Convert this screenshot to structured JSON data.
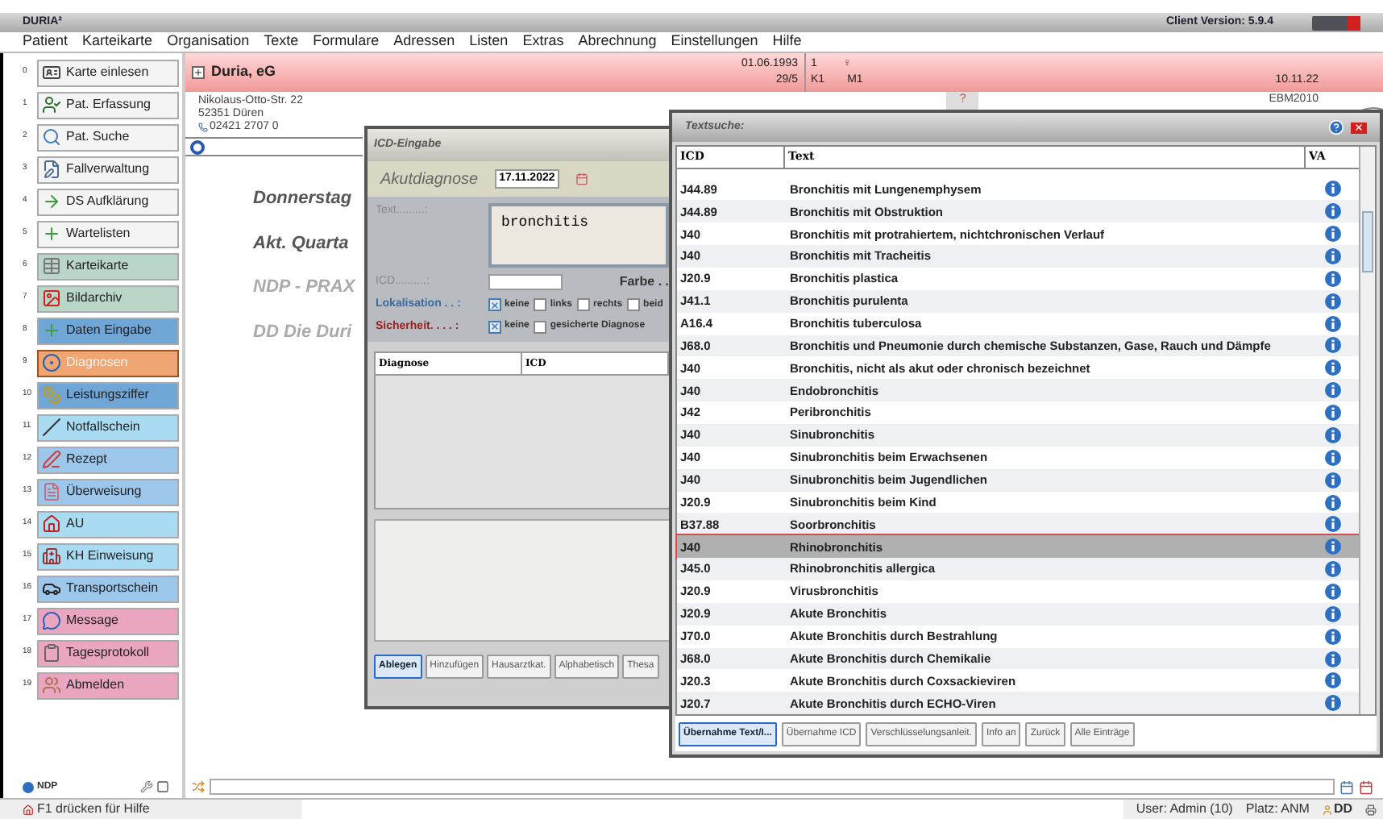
{
  "window": {
    "title": "DURIA²",
    "version": "Client Version: 5.9.4"
  },
  "menu": [
    "Patient",
    "Karteikarte",
    "Organisation",
    "Texte",
    "Formulare",
    "Adressen",
    "Listen",
    "Extras",
    "Abrechnung",
    "Einstellungen",
    "Hilfe"
  ],
  "sidebar": {
    "items": [
      {
        "number": "0",
        "label": "Karte einlesen",
        "color": "#f4f4f4",
        "selected": false
      },
      {
        "number": "1",
        "label": "Pat. Erfassung",
        "color": "#f4f4f4",
        "selected": false
      },
      {
        "number": "2",
        "label": "Pat. Suche",
        "color": "#f4f4f4",
        "selected": false
      },
      {
        "number": "3",
        "label": "Fallverwaltung",
        "color": "#f4f4f4",
        "selected": false
      },
      {
        "number": "4",
        "label": "DS Aufklärung",
        "color": "#f4f4f4",
        "selected": false
      },
      {
        "number": "5",
        "label": "Wartelisten",
        "color": "#f4f4f4",
        "selected": false
      },
      {
        "number": "6",
        "label": "Karteikarte",
        "color": "#b9d6c9",
        "selected": false
      },
      {
        "number": "7",
        "label": "Bildarchiv",
        "color": "#b9d6c9",
        "selected": false
      },
      {
        "number": "8",
        "label": "Daten Eingabe",
        "color": "#6fa6d6",
        "selected": false
      },
      {
        "number": "9",
        "label": "Diagnosen",
        "color": "#f0a672",
        "selected": true
      },
      {
        "number": "10",
        "label": "Leistungsziffer",
        "color": "#6fa6d6",
        "selected": false
      },
      {
        "number": "11",
        "label": "Notfallschein",
        "color": "#a9dcf2",
        "selected": false
      },
      {
        "number": "12",
        "label": "Rezept",
        "color": "#9cc6ea",
        "selected": false
      },
      {
        "number": "13",
        "label": "Überweisung",
        "color": "#9cc6ea",
        "selected": false
      },
      {
        "number": "14",
        "label": "AU",
        "color": "#a9dcf2",
        "selected": false
      },
      {
        "number": "15",
        "label": "KH Einweisung",
        "color": "#a9dcf2",
        "selected": false
      },
      {
        "number": "16",
        "label": "Transportschein",
        "color": "#9cc6ea",
        "selected": false
      },
      {
        "number": "17",
        "label": "Message",
        "color": "#eaa6c0",
        "selected": false
      },
      {
        "number": "18",
        "label": "Tagesprotokoll",
        "color": "#eaa6c0",
        "selected": false
      },
      {
        "number": "19",
        "label": "Abmelden",
        "color": "#eaa6c0",
        "selected": false
      }
    ],
    "footer": "NDP"
  },
  "patient": {
    "name": "Duria, eG",
    "birthdate": "01.06.1993",
    "code": "29/5",
    "count": "1",
    "gender": "♀",
    "k": "K1",
    "m": "M1",
    "date": "10.11.22",
    "question": "?",
    "ebm": "EBM2010",
    "street": "Nikolaus-Otto-Str. 22",
    "city": "52351 Düren",
    "phone": "02421 2707 0"
  },
  "main_lines": [
    "Donnerstag",
    "Akt. Quarta",
    "NDP - PRAX",
    "DD Die Duri"
  ],
  "icd_dialog": {
    "title": "ICD-Eingabe",
    "heading": "Akutdiagnose",
    "date": "17.11.2022",
    "text_label": "Text.........:",
    "text_value": "bronchitis",
    "icd_label": "ICD..........:",
    "farbe_label": "Farbe . .",
    "lokalisation_label": "Lokalisation . . :",
    "lokalisation": [
      {
        "label": "keine",
        "checked": true
      },
      {
        "label": "links",
        "checked": false
      },
      {
        "label": "rechts",
        "checked": false
      },
      {
        "label": "beid",
        "checked": false
      }
    ],
    "sicherheit_label": "Sicherheit. . . . :",
    "sicherheit": [
      {
        "label": "keine",
        "checked": true
      },
      {
        "label": "gesicherte Diagnose",
        "checked": false
      }
    ],
    "columns": [
      "Diagnose",
      "ICD"
    ],
    "buttons": [
      {
        "label": "Ablegen",
        "default": true
      },
      {
        "label": "Hinzufügen",
        "default": false
      },
      {
        "label": "Hausarztkat.",
        "default": false
      },
      {
        "label": "Alphabetisch",
        "default": false
      },
      {
        "label": "Thesa",
        "default": false
      }
    ]
  },
  "textsuche": {
    "title": "Textsuche:",
    "columns": [
      "ICD",
      "Text",
      "VA"
    ],
    "rows": [
      {
        "icd": "J44.89",
        "text": "Bronchitis mit Lungenemphysem",
        "selected": false
      },
      {
        "icd": "J44.89",
        "text": "Bronchitis mit Obstruktion",
        "selected": false
      },
      {
        "icd": "J40",
        "text": "Bronchitis mit protrahiertem, nichtchronischen Verlauf",
        "selected": false
      },
      {
        "icd": "J40",
        "text": "Bronchitis mit Tracheitis",
        "selected": false
      },
      {
        "icd": "J20.9",
        "text": "Bronchitis plastica",
        "selected": false
      },
      {
        "icd": "J41.1",
        "text": "Bronchitis purulenta",
        "selected": false
      },
      {
        "icd": "A16.4",
        "text": "Bronchitis tuberculosa",
        "selected": false
      },
      {
        "icd": "J68.0",
        "text": "Bronchitis und Pneumonie durch chemische Substanzen, Gase, Rauch und Dämpfe",
        "selected": false
      },
      {
        "icd": "J40",
        "text": "Bronchitis, nicht als akut oder chronisch bezeichnet",
        "selected": false
      },
      {
        "icd": "J40",
        "text": "Endobronchitis",
        "selected": false
      },
      {
        "icd": "J42",
        "text": "Peribronchitis",
        "selected": false
      },
      {
        "icd": "J40",
        "text": "Sinubronchitis",
        "selected": false
      },
      {
        "icd": "J40",
        "text": "Sinubronchitis beim Erwachsenen",
        "selected": false
      },
      {
        "icd": "J40",
        "text": "Sinubronchitis beim Jugendlichen",
        "selected": false
      },
      {
        "icd": "J20.9",
        "text": "Sinubronchitis beim Kind",
        "selected": false
      },
      {
        "icd": "B37.88",
        "text": "Soorbronchitis",
        "selected": false
      },
      {
        "icd": "J40",
        "text": "Rhinobronchitis",
        "selected": true
      },
      {
        "icd": "J45.0",
        "text": "Rhinobronchitis allergica",
        "selected": false
      },
      {
        "icd": "J20.9",
        "text": "Virusbronchitis",
        "selected": false
      },
      {
        "icd": "J20.9",
        "text": "Akute Bronchitis",
        "selected": false
      },
      {
        "icd": "J70.0",
        "text": "Akute Bronchitis durch Bestrahlung",
        "selected": false
      },
      {
        "icd": "J68.0",
        "text": "Akute Bronchitis durch Chemikalie",
        "selected": false
      },
      {
        "icd": "J20.3",
        "text": "Akute Bronchitis durch Coxsackieviren",
        "selected": false
      },
      {
        "icd": "J20.7",
        "text": "Akute Bronchitis durch ECHO-Viren",
        "selected": false
      }
    ],
    "buttons": [
      {
        "label": "Übernahme Text/I...",
        "default": true
      },
      {
        "label": "Übernahme ICD",
        "default": false
      },
      {
        "label": "Verschlüsselungsanleit.",
        "default": false
      },
      {
        "label": "Info an",
        "default": false
      },
      {
        "label": "Zurück",
        "default": false
      },
      {
        "label": "Alle Einträge",
        "default": false
      }
    ]
  },
  "status_bar": {
    "help": "F1 drücken für Hilfe",
    "user": "User: Admin (10)",
    "platz": "Platz: ANM",
    "dd": "DD"
  }
}
